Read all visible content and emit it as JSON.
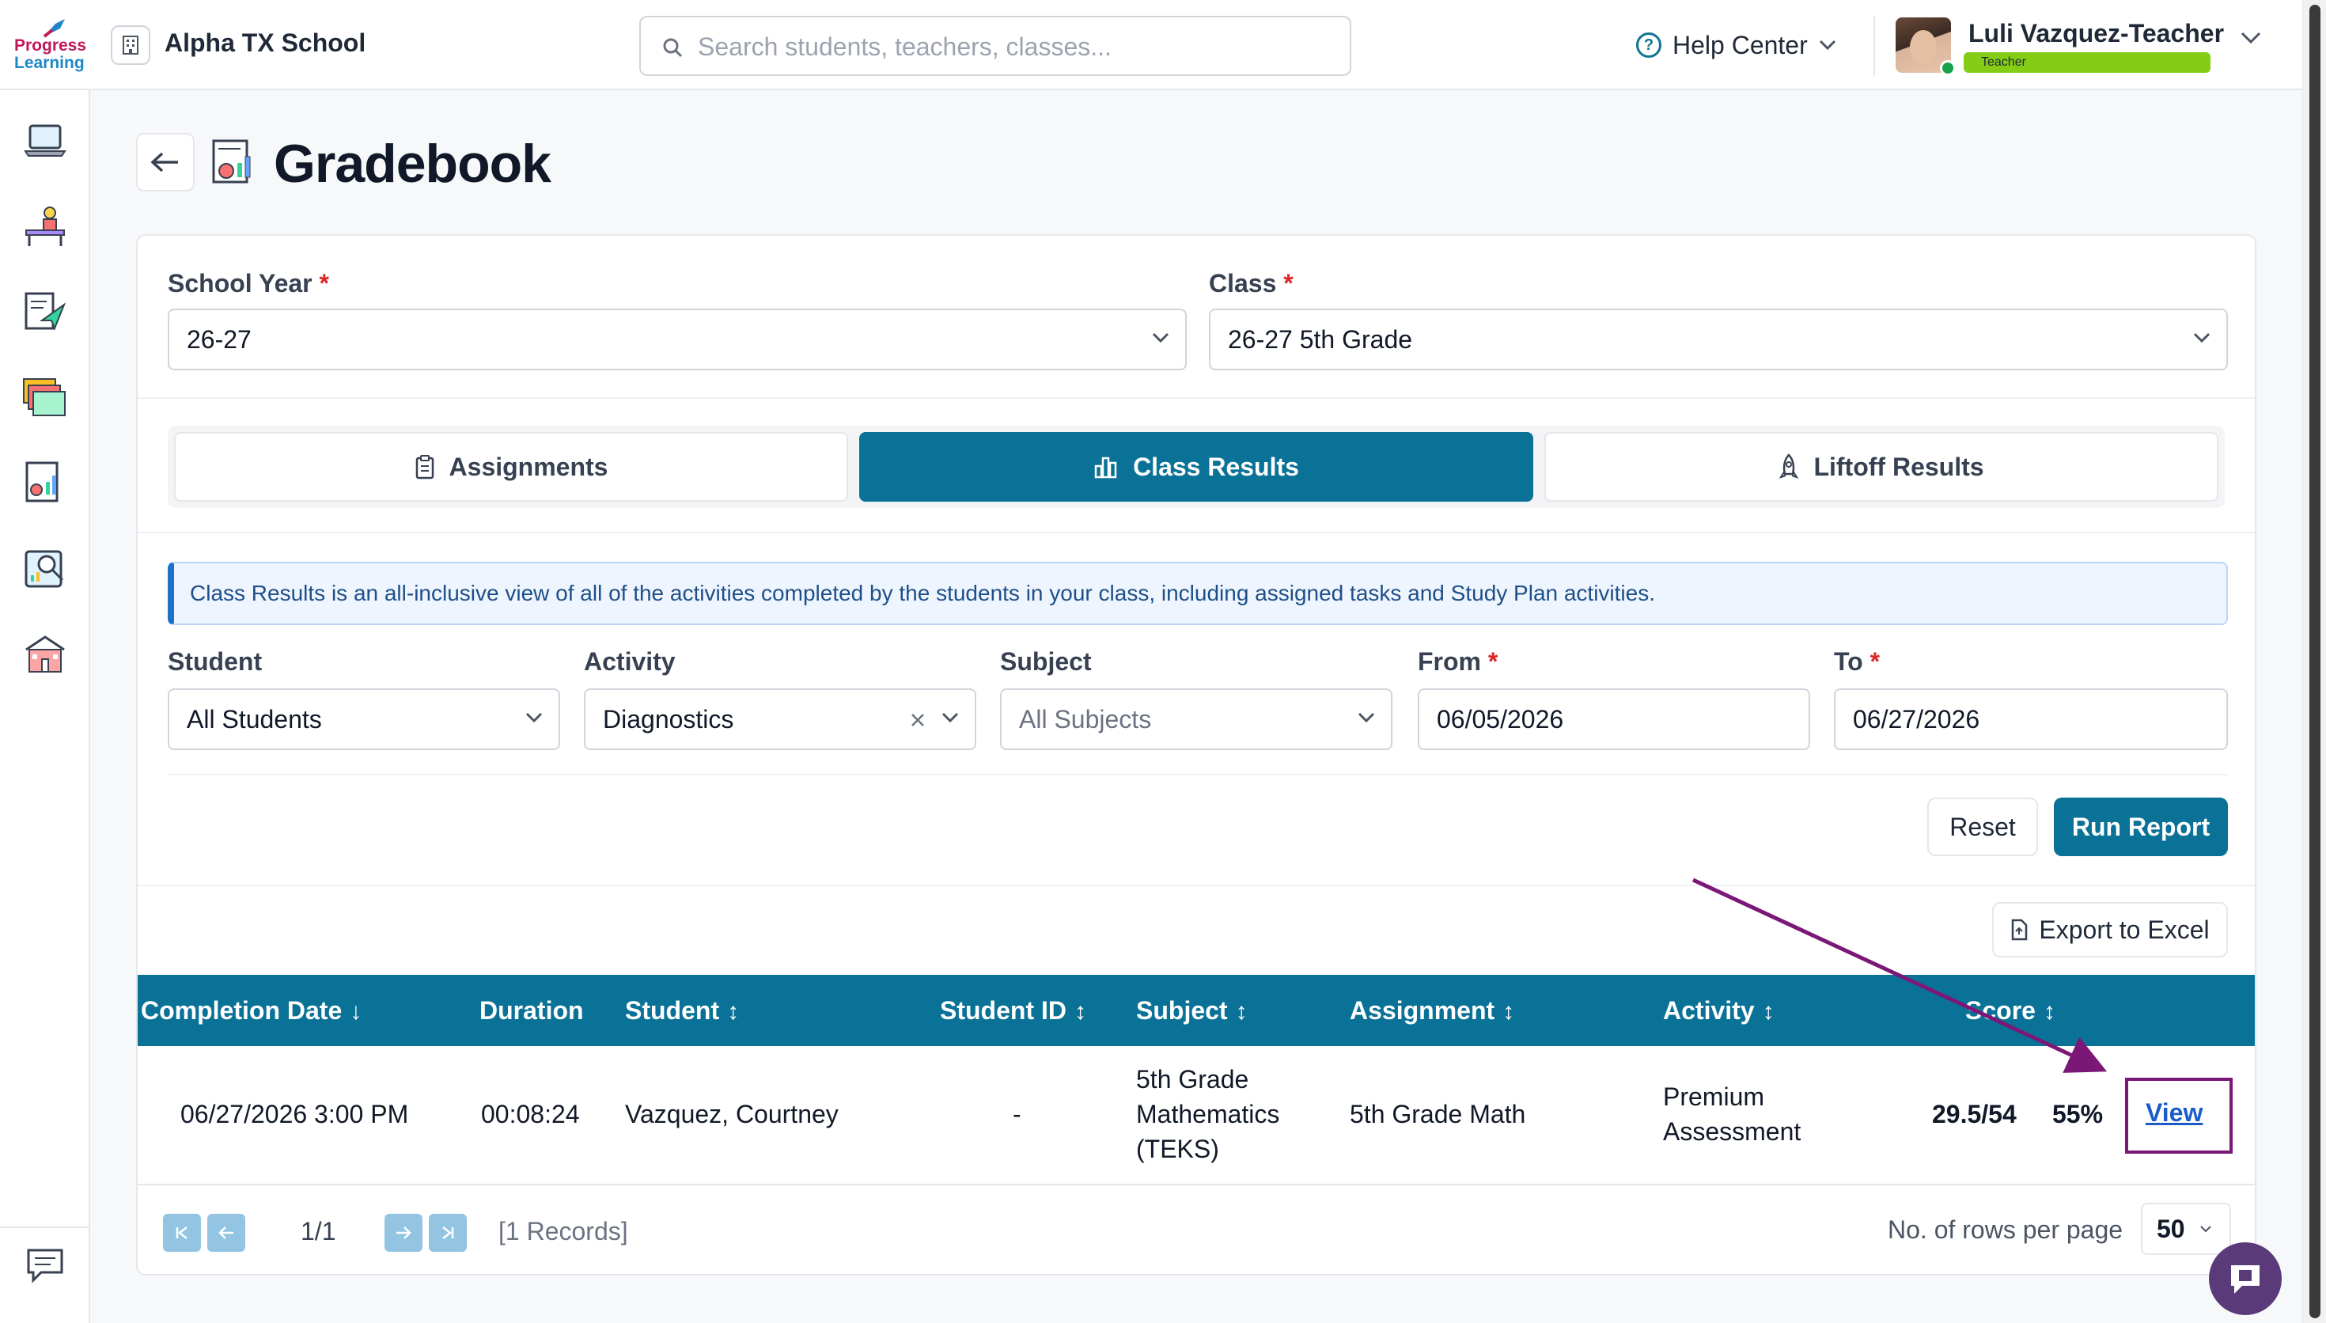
{
  "brand": {
    "logo_line1": "Progress",
    "logo_line2": "Learning"
  },
  "header": {
    "school_name": "Alpha TX School",
    "search_placeholder": "Search students, teachers, classes...",
    "help_label": "Help Center",
    "user_name": "Luli Vazquez-Teacher",
    "user_role": "Teacher"
  },
  "page": {
    "title": "Gradebook"
  },
  "filters_top": {
    "school_year_label": "School Year",
    "school_year_value": "26-27",
    "class_label": "Class",
    "class_value": "26-27 5th Grade",
    "required_mark": "*"
  },
  "tabs": [
    {
      "label": "Assignments",
      "active": false
    },
    {
      "label": "Class Results",
      "active": true
    },
    {
      "label": "Liftoff Results",
      "active": false
    }
  ],
  "info_text": "Class Results is an all-inclusive view of all of the activities completed by the students in your class, including assigned tasks and Study Plan activities.",
  "filters": {
    "student_label": "Student",
    "student_value": "All Students",
    "activity_label": "Activity",
    "activity_value": "Diagnostics",
    "subject_label": "Subject",
    "subject_placeholder": "All Subjects",
    "from_label": "From",
    "from_value": "06/05/2026",
    "to_label": "To",
    "to_value": "06/27/2026"
  },
  "buttons": {
    "reset": "Reset",
    "run_report": "Run Report",
    "export": "Export to Excel"
  },
  "table": {
    "headers": {
      "completion_date": "Completion Date",
      "duration": "Duration",
      "student": "Student",
      "student_id": "Student ID",
      "subject": "Subject",
      "assignment": "Assignment",
      "activity": "Activity",
      "score": "Score"
    },
    "rows": [
      {
        "completion_date": "06/27/2026 3:00 PM",
        "duration": "00:08:24",
        "student": "Vazquez, Courtney",
        "student_id": "-",
        "subject_lines": [
          "5th Grade",
          "Mathematics",
          "(TEKS)"
        ],
        "assignment": "5th Grade Math",
        "activity_lines": [
          "Premium",
          "Assessment"
        ],
        "score": "29.5/54",
        "percent": "55%",
        "action": "View"
      }
    ]
  },
  "pagination": {
    "page": "1/1",
    "records": "[1 Records]",
    "rows_label": "No. of rows per page",
    "rows_value": "50"
  },
  "colors": {
    "primary": "#0b7297",
    "annotation": "#7b1877",
    "link": "#1a5bc9"
  }
}
